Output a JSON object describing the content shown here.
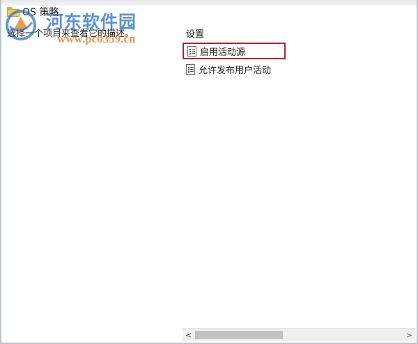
{
  "description_pane": {
    "title": "OS 策略",
    "description": "选择一个项目来查看它的描述。"
  },
  "watermark": {
    "title": "河东软件园",
    "url": "www.pc0359.cn"
  },
  "settings_pane": {
    "heading": "设置",
    "items": [
      {
        "label": "启用活动源",
        "icon": "policy-setting-icon",
        "selected": true
      },
      {
        "label": "允许发布用户活动",
        "icon": "policy-setting-icon",
        "selected": false
      }
    ]
  },
  "scrollbar": {
    "left_arrow": "<",
    "right_arrow": ">"
  },
  "colors": {
    "highlight_border": "#b0242c",
    "watermark_blue": "#246ebe",
    "watermark_orange": "#e2781e"
  }
}
